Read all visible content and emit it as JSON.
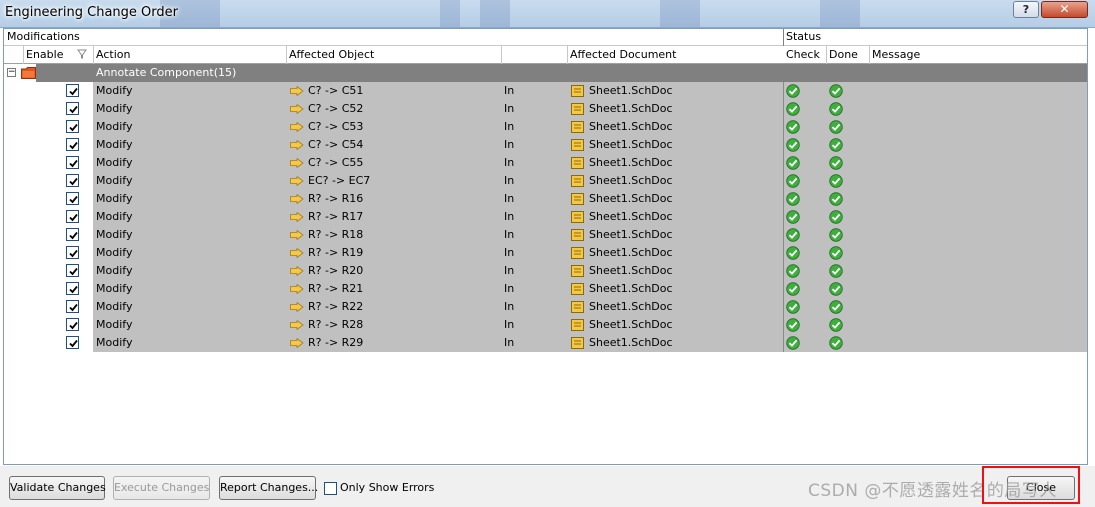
{
  "window": {
    "title": "Engineering Change Order",
    "help_label": "?",
    "close_label": "✕"
  },
  "grid": {
    "group_headers": {
      "modifications": "Modifications",
      "status": "Status"
    },
    "columns": {
      "enable": "Enable",
      "action": "Action",
      "affected_object": "Affected Object",
      "affected_document": "Affected Document",
      "check": "Check",
      "done": "Done",
      "message": "Message"
    },
    "group": {
      "label": "Annotate Component(15)",
      "expanded": true
    },
    "rows": [
      {
        "enabled": true,
        "action": "Modify",
        "object": "C? -> C51",
        "direction": "In",
        "document": "Sheet1.SchDoc",
        "check": "ok",
        "done": "ok"
      },
      {
        "enabled": true,
        "action": "Modify",
        "object": "C? -> C52",
        "direction": "In",
        "document": "Sheet1.SchDoc",
        "check": "ok",
        "done": "ok"
      },
      {
        "enabled": true,
        "action": "Modify",
        "object": "C? -> C53",
        "direction": "In",
        "document": "Sheet1.SchDoc",
        "check": "ok",
        "done": "ok"
      },
      {
        "enabled": true,
        "action": "Modify",
        "object": "C? -> C54",
        "direction": "In",
        "document": "Sheet1.SchDoc",
        "check": "ok",
        "done": "ok"
      },
      {
        "enabled": true,
        "action": "Modify",
        "object": "C? -> C55",
        "direction": "In",
        "document": "Sheet1.SchDoc",
        "check": "ok",
        "done": "ok"
      },
      {
        "enabled": true,
        "action": "Modify",
        "object": "EC? -> EC7",
        "direction": "In",
        "document": "Sheet1.SchDoc",
        "check": "ok",
        "done": "ok"
      },
      {
        "enabled": true,
        "action": "Modify",
        "object": "R? -> R16",
        "direction": "In",
        "document": "Sheet1.SchDoc",
        "check": "ok",
        "done": "ok"
      },
      {
        "enabled": true,
        "action": "Modify",
        "object": "R? -> R17",
        "direction": "In",
        "document": "Sheet1.SchDoc",
        "check": "ok",
        "done": "ok"
      },
      {
        "enabled": true,
        "action": "Modify",
        "object": "R? -> R18",
        "direction": "In",
        "document": "Sheet1.SchDoc",
        "check": "ok",
        "done": "ok"
      },
      {
        "enabled": true,
        "action": "Modify",
        "object": "R? -> R19",
        "direction": "In",
        "document": "Sheet1.SchDoc",
        "check": "ok",
        "done": "ok"
      },
      {
        "enabled": true,
        "action": "Modify",
        "object": "R? -> R20",
        "direction": "In",
        "document": "Sheet1.SchDoc",
        "check": "ok",
        "done": "ok"
      },
      {
        "enabled": true,
        "action": "Modify",
        "object": "R? -> R21",
        "direction": "In",
        "document": "Sheet1.SchDoc",
        "check": "ok",
        "done": "ok"
      },
      {
        "enabled": true,
        "action": "Modify",
        "object": "R? -> R22",
        "direction": "In",
        "document": "Sheet1.SchDoc",
        "check": "ok",
        "done": "ok"
      },
      {
        "enabled": true,
        "action": "Modify",
        "object": "R? -> R28",
        "direction": "In",
        "document": "Sheet1.SchDoc",
        "check": "ok",
        "done": "ok"
      },
      {
        "enabled": true,
        "action": "Modify",
        "object": "R? -> R29",
        "direction": "In",
        "document": "Sheet1.SchDoc",
        "check": "ok",
        "done": "ok"
      }
    ]
  },
  "footer": {
    "validate_label": "Validate Changes",
    "execute_label": "Execute Changes",
    "report_label": "Report Changes...",
    "only_errors_label": "Only Show Errors",
    "only_errors_checked": false,
    "close_label": "Close",
    "watermark": "CSDN @不愿透露姓名的局写人"
  },
  "colors": {
    "row_band": "#c0c0c0",
    "group_band": "#808080",
    "ok_green": "#3fae3f",
    "highlight_red": "#ee1111"
  },
  "icons": {
    "object": "component-arrow-icon",
    "document": "schematic-document-icon",
    "status": "green-check-icon",
    "group": "folder-icon"
  }
}
